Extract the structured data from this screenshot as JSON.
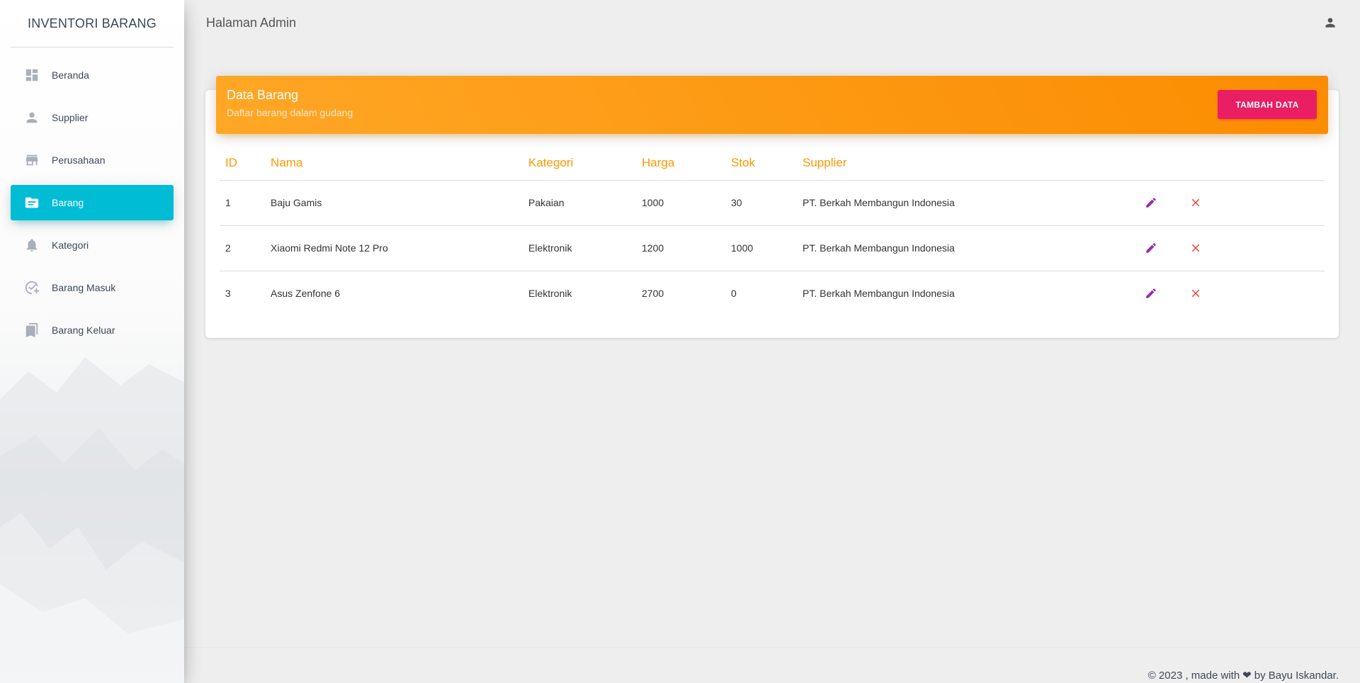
{
  "sidebar": {
    "brand": "INVENTORI BARANG",
    "items": [
      {
        "label": "Beranda",
        "icon": "dashboard-icon"
      },
      {
        "label": "Supplier",
        "icon": "person-icon"
      },
      {
        "label": "Perusahaan",
        "icon": "store-icon"
      },
      {
        "label": "Barang",
        "icon": "folder-icon",
        "active": true
      },
      {
        "label": "Kategori",
        "icon": "bell-icon"
      },
      {
        "label": "Barang Masuk",
        "icon": "check-add-icon"
      },
      {
        "label": "Barang Keluar",
        "icon": "bookmarks-icon"
      }
    ]
  },
  "topbar": {
    "title": "Halaman Admin",
    "user_icon": "person-icon"
  },
  "card": {
    "title": "Data Barang",
    "subtitle": "Daftar barang dalam gudang",
    "add_button": "TAMBAH DATA"
  },
  "table": {
    "headers": [
      "ID",
      "Nama",
      "Kategori",
      "Harga",
      "Stok",
      "Supplier"
    ],
    "rows": [
      {
        "id": "1",
        "nama": "Baju Gamis",
        "kategori": "Pakaian",
        "harga": "1000",
        "stok": "30",
        "supplier": "PT. Berkah Membangun Indonesia"
      },
      {
        "id": "2",
        "nama": "Xiaomi Redmi Note 12 Pro",
        "kategori": "Elektronik",
        "harga": "1200",
        "stok": "1000",
        "supplier": "PT. Berkah Membangun Indonesia"
      },
      {
        "id": "3",
        "nama": "Asus Zenfone 6",
        "kategori": "Elektronik",
        "harga": "2700",
        "stok": "0",
        "supplier": "PT. Berkah Membangun Indonesia"
      }
    ]
  },
  "footer": {
    "prefix": "© 2023 , made with",
    "suffix": "by Bayu Iskandar."
  },
  "colors": {
    "accent": "#00bcd4",
    "header_orange": "#ff9800",
    "button_pink": "#e91e63",
    "edit_purple": "#9c27b0",
    "delete_red": "#f44336"
  }
}
